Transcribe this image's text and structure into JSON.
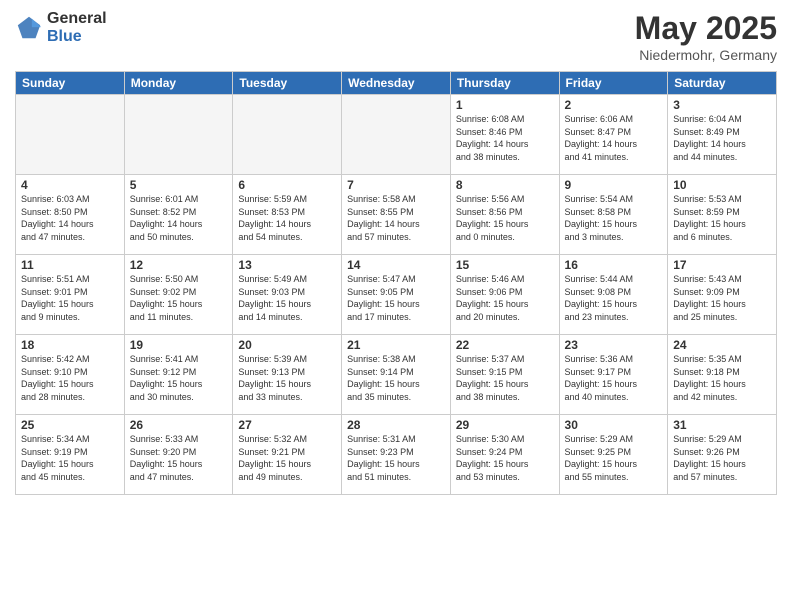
{
  "logo": {
    "general": "General",
    "blue": "Blue"
  },
  "header": {
    "month": "May 2025",
    "location": "Niedermohr, Germany"
  },
  "weekdays": [
    "Sunday",
    "Monday",
    "Tuesday",
    "Wednesday",
    "Thursday",
    "Friday",
    "Saturday"
  ],
  "weeks": [
    [
      {
        "day": "",
        "info": ""
      },
      {
        "day": "",
        "info": ""
      },
      {
        "day": "",
        "info": ""
      },
      {
        "day": "",
        "info": ""
      },
      {
        "day": "1",
        "info": "Sunrise: 6:08 AM\nSunset: 8:46 PM\nDaylight: 14 hours\nand 38 minutes."
      },
      {
        "day": "2",
        "info": "Sunrise: 6:06 AM\nSunset: 8:47 PM\nDaylight: 14 hours\nand 41 minutes."
      },
      {
        "day": "3",
        "info": "Sunrise: 6:04 AM\nSunset: 8:49 PM\nDaylight: 14 hours\nand 44 minutes."
      }
    ],
    [
      {
        "day": "4",
        "info": "Sunrise: 6:03 AM\nSunset: 8:50 PM\nDaylight: 14 hours\nand 47 minutes."
      },
      {
        "day": "5",
        "info": "Sunrise: 6:01 AM\nSunset: 8:52 PM\nDaylight: 14 hours\nand 50 minutes."
      },
      {
        "day": "6",
        "info": "Sunrise: 5:59 AM\nSunset: 8:53 PM\nDaylight: 14 hours\nand 54 minutes."
      },
      {
        "day": "7",
        "info": "Sunrise: 5:58 AM\nSunset: 8:55 PM\nDaylight: 14 hours\nand 57 minutes."
      },
      {
        "day": "8",
        "info": "Sunrise: 5:56 AM\nSunset: 8:56 PM\nDaylight: 15 hours\nand 0 minutes."
      },
      {
        "day": "9",
        "info": "Sunrise: 5:54 AM\nSunset: 8:58 PM\nDaylight: 15 hours\nand 3 minutes."
      },
      {
        "day": "10",
        "info": "Sunrise: 5:53 AM\nSunset: 8:59 PM\nDaylight: 15 hours\nand 6 minutes."
      }
    ],
    [
      {
        "day": "11",
        "info": "Sunrise: 5:51 AM\nSunset: 9:01 PM\nDaylight: 15 hours\nand 9 minutes."
      },
      {
        "day": "12",
        "info": "Sunrise: 5:50 AM\nSunset: 9:02 PM\nDaylight: 15 hours\nand 11 minutes."
      },
      {
        "day": "13",
        "info": "Sunrise: 5:49 AM\nSunset: 9:03 PM\nDaylight: 15 hours\nand 14 minutes."
      },
      {
        "day": "14",
        "info": "Sunrise: 5:47 AM\nSunset: 9:05 PM\nDaylight: 15 hours\nand 17 minutes."
      },
      {
        "day": "15",
        "info": "Sunrise: 5:46 AM\nSunset: 9:06 PM\nDaylight: 15 hours\nand 20 minutes."
      },
      {
        "day": "16",
        "info": "Sunrise: 5:44 AM\nSunset: 9:08 PM\nDaylight: 15 hours\nand 23 minutes."
      },
      {
        "day": "17",
        "info": "Sunrise: 5:43 AM\nSunset: 9:09 PM\nDaylight: 15 hours\nand 25 minutes."
      }
    ],
    [
      {
        "day": "18",
        "info": "Sunrise: 5:42 AM\nSunset: 9:10 PM\nDaylight: 15 hours\nand 28 minutes."
      },
      {
        "day": "19",
        "info": "Sunrise: 5:41 AM\nSunset: 9:12 PM\nDaylight: 15 hours\nand 30 minutes."
      },
      {
        "day": "20",
        "info": "Sunrise: 5:39 AM\nSunset: 9:13 PM\nDaylight: 15 hours\nand 33 minutes."
      },
      {
        "day": "21",
        "info": "Sunrise: 5:38 AM\nSunset: 9:14 PM\nDaylight: 15 hours\nand 35 minutes."
      },
      {
        "day": "22",
        "info": "Sunrise: 5:37 AM\nSunset: 9:15 PM\nDaylight: 15 hours\nand 38 minutes."
      },
      {
        "day": "23",
        "info": "Sunrise: 5:36 AM\nSunset: 9:17 PM\nDaylight: 15 hours\nand 40 minutes."
      },
      {
        "day": "24",
        "info": "Sunrise: 5:35 AM\nSunset: 9:18 PM\nDaylight: 15 hours\nand 42 minutes."
      }
    ],
    [
      {
        "day": "25",
        "info": "Sunrise: 5:34 AM\nSunset: 9:19 PM\nDaylight: 15 hours\nand 45 minutes."
      },
      {
        "day": "26",
        "info": "Sunrise: 5:33 AM\nSunset: 9:20 PM\nDaylight: 15 hours\nand 47 minutes."
      },
      {
        "day": "27",
        "info": "Sunrise: 5:32 AM\nSunset: 9:21 PM\nDaylight: 15 hours\nand 49 minutes."
      },
      {
        "day": "28",
        "info": "Sunrise: 5:31 AM\nSunset: 9:23 PM\nDaylight: 15 hours\nand 51 minutes."
      },
      {
        "day": "29",
        "info": "Sunrise: 5:30 AM\nSunset: 9:24 PM\nDaylight: 15 hours\nand 53 minutes."
      },
      {
        "day": "30",
        "info": "Sunrise: 5:29 AM\nSunset: 9:25 PM\nDaylight: 15 hours\nand 55 minutes."
      },
      {
        "day": "31",
        "info": "Sunrise: 5:29 AM\nSunset: 9:26 PM\nDaylight: 15 hours\nand 57 minutes."
      }
    ]
  ]
}
